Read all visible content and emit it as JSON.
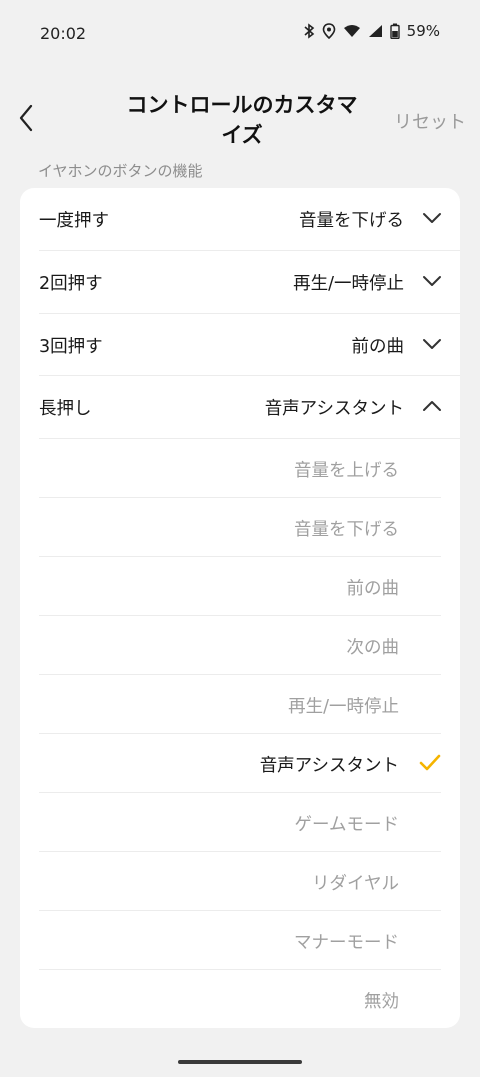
{
  "status_bar": {
    "time": "20:02",
    "battery": "59%"
  },
  "header": {
    "title": "コントロールのカスタマイズ",
    "reset_label": "リセット"
  },
  "section": {
    "label": "イヤホンのボタンの機能"
  },
  "rows": [
    {
      "label": "一度押す",
      "value": "音量を下げる",
      "expanded": false
    },
    {
      "label": "2回押す",
      "value": "再生/一時停止",
      "expanded": false
    },
    {
      "label": "3回押す",
      "value": "前の曲",
      "expanded": false
    },
    {
      "label": "長押し",
      "value": "音声アシスタント",
      "expanded": true
    }
  ],
  "options": [
    {
      "label": "音量を上げる",
      "selected": false
    },
    {
      "label": "音量を下げる",
      "selected": false
    },
    {
      "label": "前の曲",
      "selected": false
    },
    {
      "label": "次の曲",
      "selected": false
    },
    {
      "label": "再生/一時停止",
      "selected": false
    },
    {
      "label": "音声アシスタント",
      "selected": true
    },
    {
      "label": "ゲームモード",
      "selected": false
    },
    {
      "label": "リダイヤル",
      "selected": false
    },
    {
      "label": "マナーモード",
      "selected": false
    },
    {
      "label": "無効",
      "selected": false
    }
  ],
  "icons": {
    "back": "chevron-left-icon",
    "collapsed": "chevron-down-icon",
    "expanded": "chevron-up-icon",
    "selected": "check-icon"
  },
  "colors": {
    "background": "#f1f1f1",
    "card": "#ffffff",
    "accent_check": "#f5b400",
    "muted_text": "#a0a0a0"
  }
}
